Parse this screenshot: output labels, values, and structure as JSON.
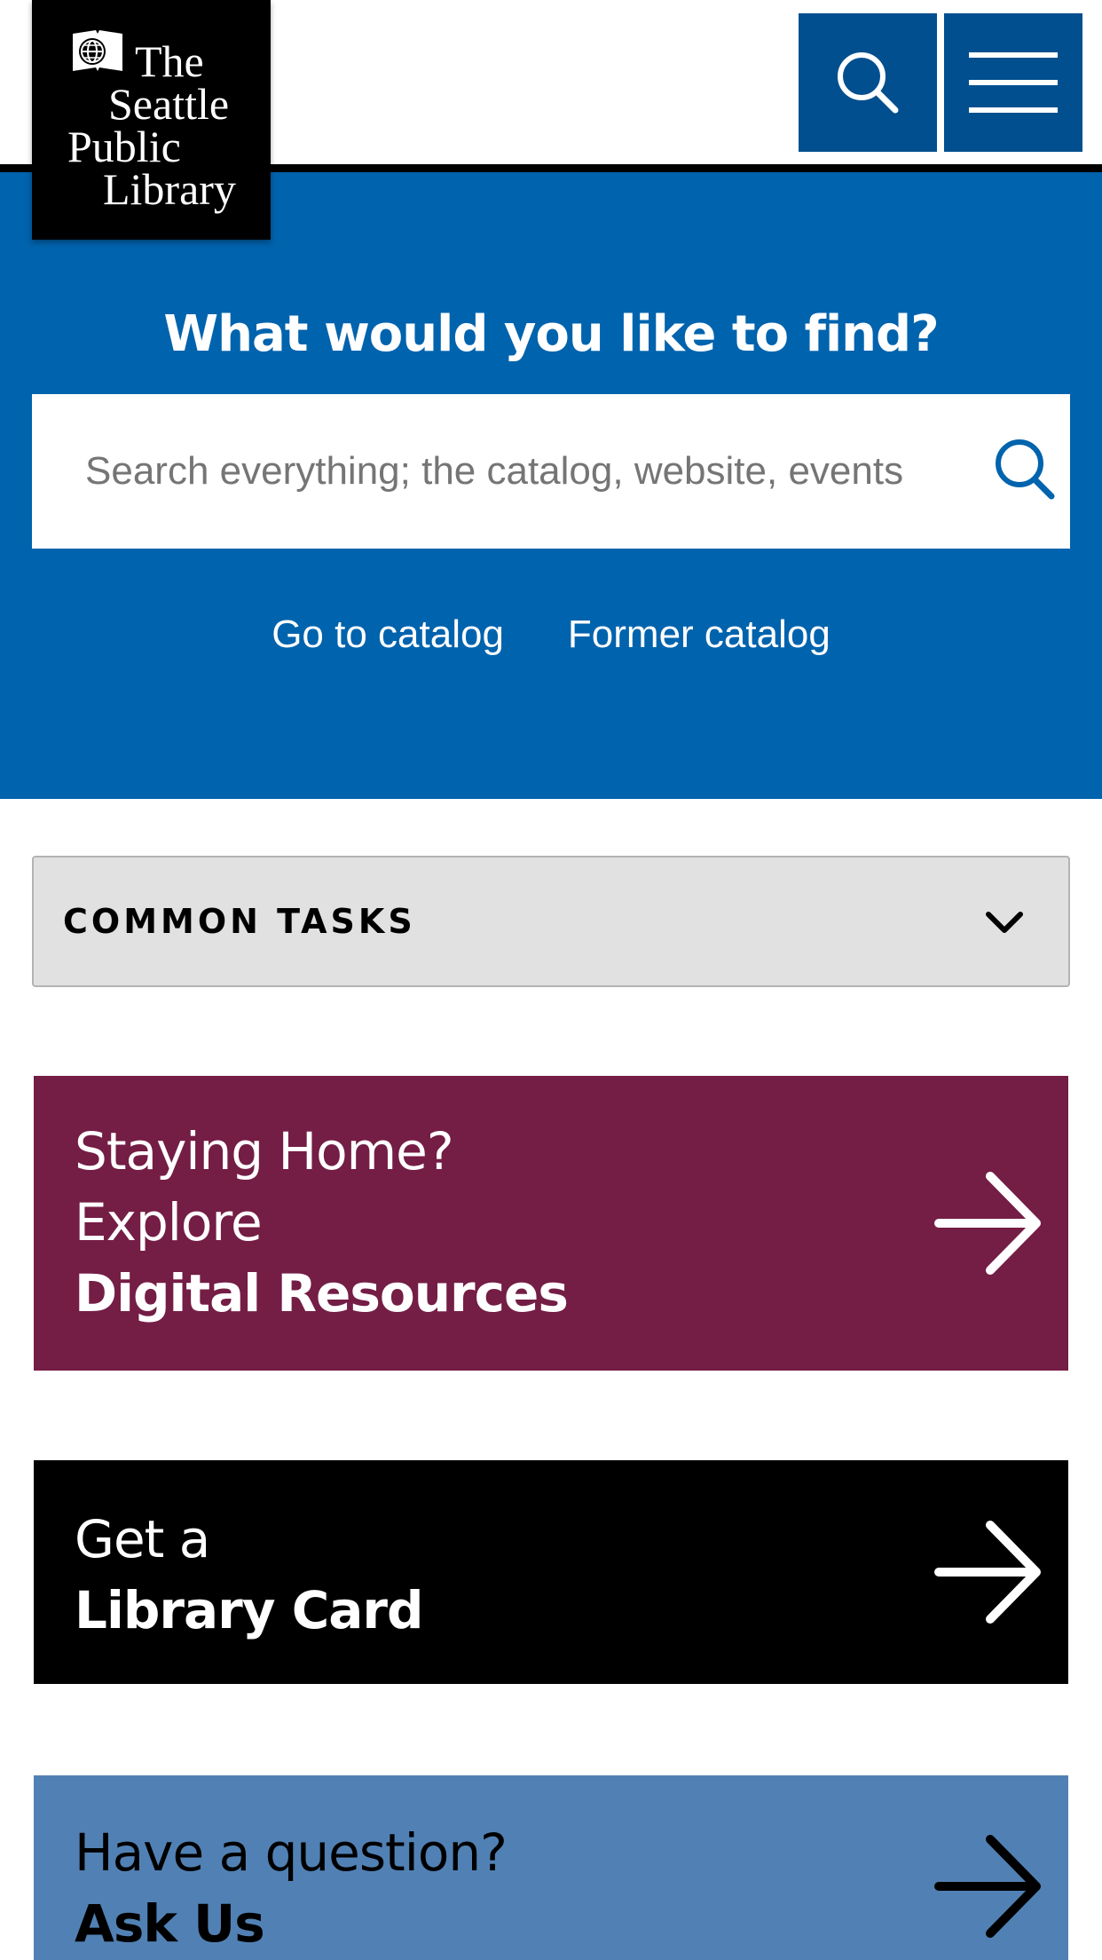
{
  "header": {
    "logo_lines": [
      "The",
      "Seattle",
      "Public",
      "Library"
    ],
    "search_button_icon": "search-icon",
    "menu_button_icon": "hamburger-menu-icon",
    "header_button_color": "#024f8f"
  },
  "hero": {
    "title": "What would you like to find?",
    "search": {
      "placeholder": "Search everything; the catalog, website, events",
      "value": "",
      "submit_icon": "search-icon"
    },
    "links": [
      "Go to catalog",
      "Former catalog"
    ],
    "background_color": "#0063ad"
  },
  "common_tasks": {
    "label": "COMMON TASKS",
    "icon": "chevron-down-icon"
  },
  "cards": [
    {
      "lines": [
        "Staying Home?",
        "Explore",
        "Digital Resources"
      ],
      "bold_line": "Digital Resources",
      "icon": "arrow-right-icon",
      "color": "#741d45"
    },
    {
      "lines": [
        "Get a",
        "Library Card"
      ],
      "bold_line": "Library Card",
      "icon": "arrow-right-icon",
      "color": "#000000"
    },
    {
      "lines": [
        "Have a question?",
        "Ask Us"
      ],
      "bold_line": "Ask Us",
      "icon": "arrow-right-icon",
      "color": "#5181b4"
    }
  ]
}
